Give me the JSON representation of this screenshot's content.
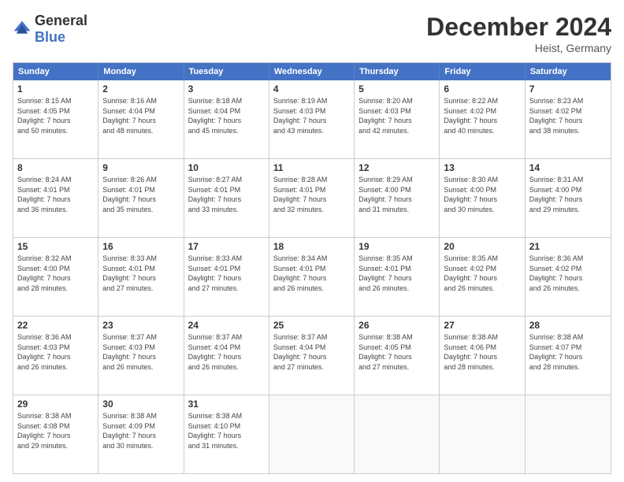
{
  "logo": {
    "general": "General",
    "blue": "Blue"
  },
  "title": "December 2024",
  "location": "Heist, Germany",
  "days": [
    "Sunday",
    "Monday",
    "Tuesday",
    "Wednesday",
    "Thursday",
    "Friday",
    "Saturday"
  ],
  "rows": [
    [
      {
        "day": "1",
        "sunrise": "8:15 AM",
        "sunset": "4:05 PM",
        "daylight": "7 hours and 50 minutes."
      },
      {
        "day": "2",
        "sunrise": "8:16 AM",
        "sunset": "4:04 PM",
        "daylight": "7 hours and 48 minutes."
      },
      {
        "day": "3",
        "sunrise": "8:18 AM",
        "sunset": "4:04 PM",
        "daylight": "7 hours and 45 minutes."
      },
      {
        "day": "4",
        "sunrise": "8:19 AM",
        "sunset": "4:03 PM",
        "daylight": "7 hours and 43 minutes."
      },
      {
        "day": "5",
        "sunrise": "8:20 AM",
        "sunset": "4:03 PM",
        "daylight": "7 hours and 42 minutes."
      },
      {
        "day": "6",
        "sunrise": "8:22 AM",
        "sunset": "4:02 PM",
        "daylight": "7 hours and 40 minutes."
      },
      {
        "day": "7",
        "sunrise": "8:23 AM",
        "sunset": "4:02 PM",
        "daylight": "7 hours and 38 minutes."
      }
    ],
    [
      {
        "day": "8",
        "sunrise": "8:24 AM",
        "sunset": "4:01 PM",
        "daylight": "7 hours and 36 minutes."
      },
      {
        "day": "9",
        "sunrise": "8:26 AM",
        "sunset": "4:01 PM",
        "daylight": "7 hours and 35 minutes."
      },
      {
        "day": "10",
        "sunrise": "8:27 AM",
        "sunset": "4:01 PM",
        "daylight": "7 hours and 33 minutes."
      },
      {
        "day": "11",
        "sunrise": "8:28 AM",
        "sunset": "4:01 PM",
        "daylight": "7 hours and 32 minutes."
      },
      {
        "day": "12",
        "sunrise": "8:29 AM",
        "sunset": "4:00 PM",
        "daylight": "7 hours and 31 minutes."
      },
      {
        "day": "13",
        "sunrise": "8:30 AM",
        "sunset": "4:00 PM",
        "daylight": "7 hours and 30 minutes."
      },
      {
        "day": "14",
        "sunrise": "8:31 AM",
        "sunset": "4:00 PM",
        "daylight": "7 hours and 29 minutes."
      }
    ],
    [
      {
        "day": "15",
        "sunrise": "8:32 AM",
        "sunset": "4:00 PM",
        "daylight": "7 hours and 28 minutes."
      },
      {
        "day": "16",
        "sunrise": "8:33 AM",
        "sunset": "4:01 PM",
        "daylight": "7 hours and 27 minutes."
      },
      {
        "day": "17",
        "sunrise": "8:33 AM",
        "sunset": "4:01 PM",
        "daylight": "7 hours and 27 minutes."
      },
      {
        "day": "18",
        "sunrise": "8:34 AM",
        "sunset": "4:01 PM",
        "daylight": "7 hours and 26 minutes."
      },
      {
        "day": "19",
        "sunrise": "8:35 AM",
        "sunset": "4:01 PM",
        "daylight": "7 hours and 26 minutes."
      },
      {
        "day": "20",
        "sunrise": "8:35 AM",
        "sunset": "4:02 PM",
        "daylight": "7 hours and 26 minutes."
      },
      {
        "day": "21",
        "sunrise": "8:36 AM",
        "sunset": "4:02 PM",
        "daylight": "7 hours and 26 minutes."
      }
    ],
    [
      {
        "day": "22",
        "sunrise": "8:36 AM",
        "sunset": "4:03 PM",
        "daylight": "7 hours and 26 minutes."
      },
      {
        "day": "23",
        "sunrise": "8:37 AM",
        "sunset": "4:03 PM",
        "daylight": "7 hours and 26 minutes."
      },
      {
        "day": "24",
        "sunrise": "8:37 AM",
        "sunset": "4:04 PM",
        "daylight": "7 hours and 26 minutes."
      },
      {
        "day": "25",
        "sunrise": "8:37 AM",
        "sunset": "4:04 PM",
        "daylight": "7 hours and 27 minutes."
      },
      {
        "day": "26",
        "sunrise": "8:38 AM",
        "sunset": "4:05 PM",
        "daylight": "7 hours and 27 minutes."
      },
      {
        "day": "27",
        "sunrise": "8:38 AM",
        "sunset": "4:06 PM",
        "daylight": "7 hours and 28 minutes."
      },
      {
        "day": "28",
        "sunrise": "8:38 AM",
        "sunset": "4:07 PM",
        "daylight": "7 hours and 28 minutes."
      }
    ],
    [
      {
        "day": "29",
        "sunrise": "8:38 AM",
        "sunset": "4:08 PM",
        "daylight": "7 hours and 29 minutes."
      },
      {
        "day": "30",
        "sunrise": "8:38 AM",
        "sunset": "4:09 PM",
        "daylight": "7 hours and 30 minutes."
      },
      {
        "day": "31",
        "sunrise": "8:38 AM",
        "sunset": "4:10 PM",
        "daylight": "7 hours and 31 minutes."
      },
      null,
      null,
      null,
      null
    ]
  ]
}
